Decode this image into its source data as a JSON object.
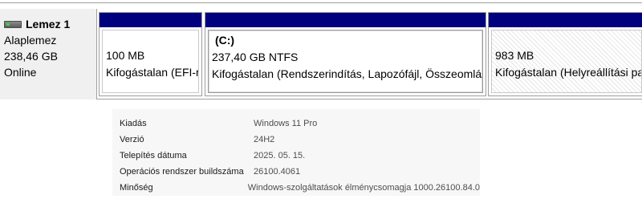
{
  "disk": {
    "title": "Lemez 1",
    "type": "Alaplemez",
    "size": "238,46 GB",
    "status": "Online",
    "icon": "hard-disk-icon"
  },
  "partitions": [
    {
      "name": "",
      "size": "100 MB",
      "status": "Kifogástalan (EFI-rendszerpartíció)"
    },
    {
      "name": "(C:)",
      "size": "237,40 GB NTFS",
      "status": "Kifogástalan (Rendszerindítás, Lapozófájl, Összeomlási"
    },
    {
      "name": "",
      "size": "983 MB",
      "status": "Kifogástalan (Helyreállítási partíció)"
    }
  ],
  "colors": {
    "partition_header": "#00007f",
    "panel_bg": "#f0f0f0"
  },
  "specs": [
    {
      "key": "Kiadás",
      "value": "Windows 11 Pro"
    },
    {
      "key": "Verzió",
      "value": "24H2"
    },
    {
      "key": "Telepítés dátuma",
      "value": "2025. 05. 15."
    },
    {
      "key": "Operációs rendszer buildszáma",
      "value": "26100.4061"
    },
    {
      "key": "Minőség",
      "value": "Windows-szolgáltatások élménycsomagja 1000.26100.84.0"
    }
  ]
}
